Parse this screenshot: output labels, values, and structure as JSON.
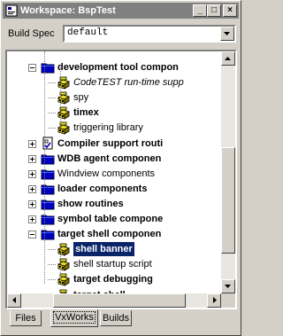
{
  "window": {
    "title": "Workspace: BspTest",
    "buttons": {
      "minimize": "_",
      "maximize": "□",
      "close": "×"
    }
  },
  "build_spec": {
    "label": "Build Spec",
    "value": "default"
  },
  "tree": {
    "items": [
      {
        "label": "development tool compon",
        "icon": "folder-icon",
        "style": "bold",
        "expander": "minus"
      },
      {
        "label": "CodeTEST run-time supp",
        "icon": "component-icon",
        "style": "italic"
      },
      {
        "label": "spy",
        "icon": "component-icon",
        "style": "normal"
      },
      {
        "label": "timex",
        "icon": "component-icon",
        "style": "bold"
      },
      {
        "label": "triggering library",
        "icon": "component-icon",
        "style": "normal"
      },
      {
        "label": "Compiler support routi",
        "icon": "checklist-icon",
        "style": "bold",
        "expander": "plus"
      },
      {
        "label": "WDB agent componen",
        "icon": "folder-icon",
        "style": "bold",
        "expander": "plus"
      },
      {
        "label": "Windview components",
        "icon": "folder-icon",
        "style": "normal",
        "expander": "plus"
      },
      {
        "label": "loader components",
        "icon": "folder-icon",
        "style": "bold",
        "expander": "plus"
      },
      {
        "label": "show routines",
        "icon": "folder-icon",
        "style": "bold",
        "expander": "plus"
      },
      {
        "label": "symbol table compone",
        "icon": "folder-icon",
        "style": "bold",
        "expander": "plus"
      },
      {
        "label": "target shell componen",
        "icon": "folder-icon",
        "style": "bold",
        "expander": "minus"
      },
      {
        "label": "shell banner",
        "icon": "component-icon",
        "style": "bold",
        "selected": true
      },
      {
        "label": "shell startup script",
        "icon": "component-icon",
        "style": "normal"
      },
      {
        "label": "target debugging",
        "icon": "component-icon",
        "style": "bold"
      },
      {
        "label": "target shell",
        "icon": "component-icon",
        "style": "bold"
      }
    ]
  },
  "tabs": [
    {
      "label": "Files"
    },
    {
      "label": "VxWorks"
    },
    {
      "label": "Builds"
    }
  ],
  "active_tab": "VxWorks"
}
